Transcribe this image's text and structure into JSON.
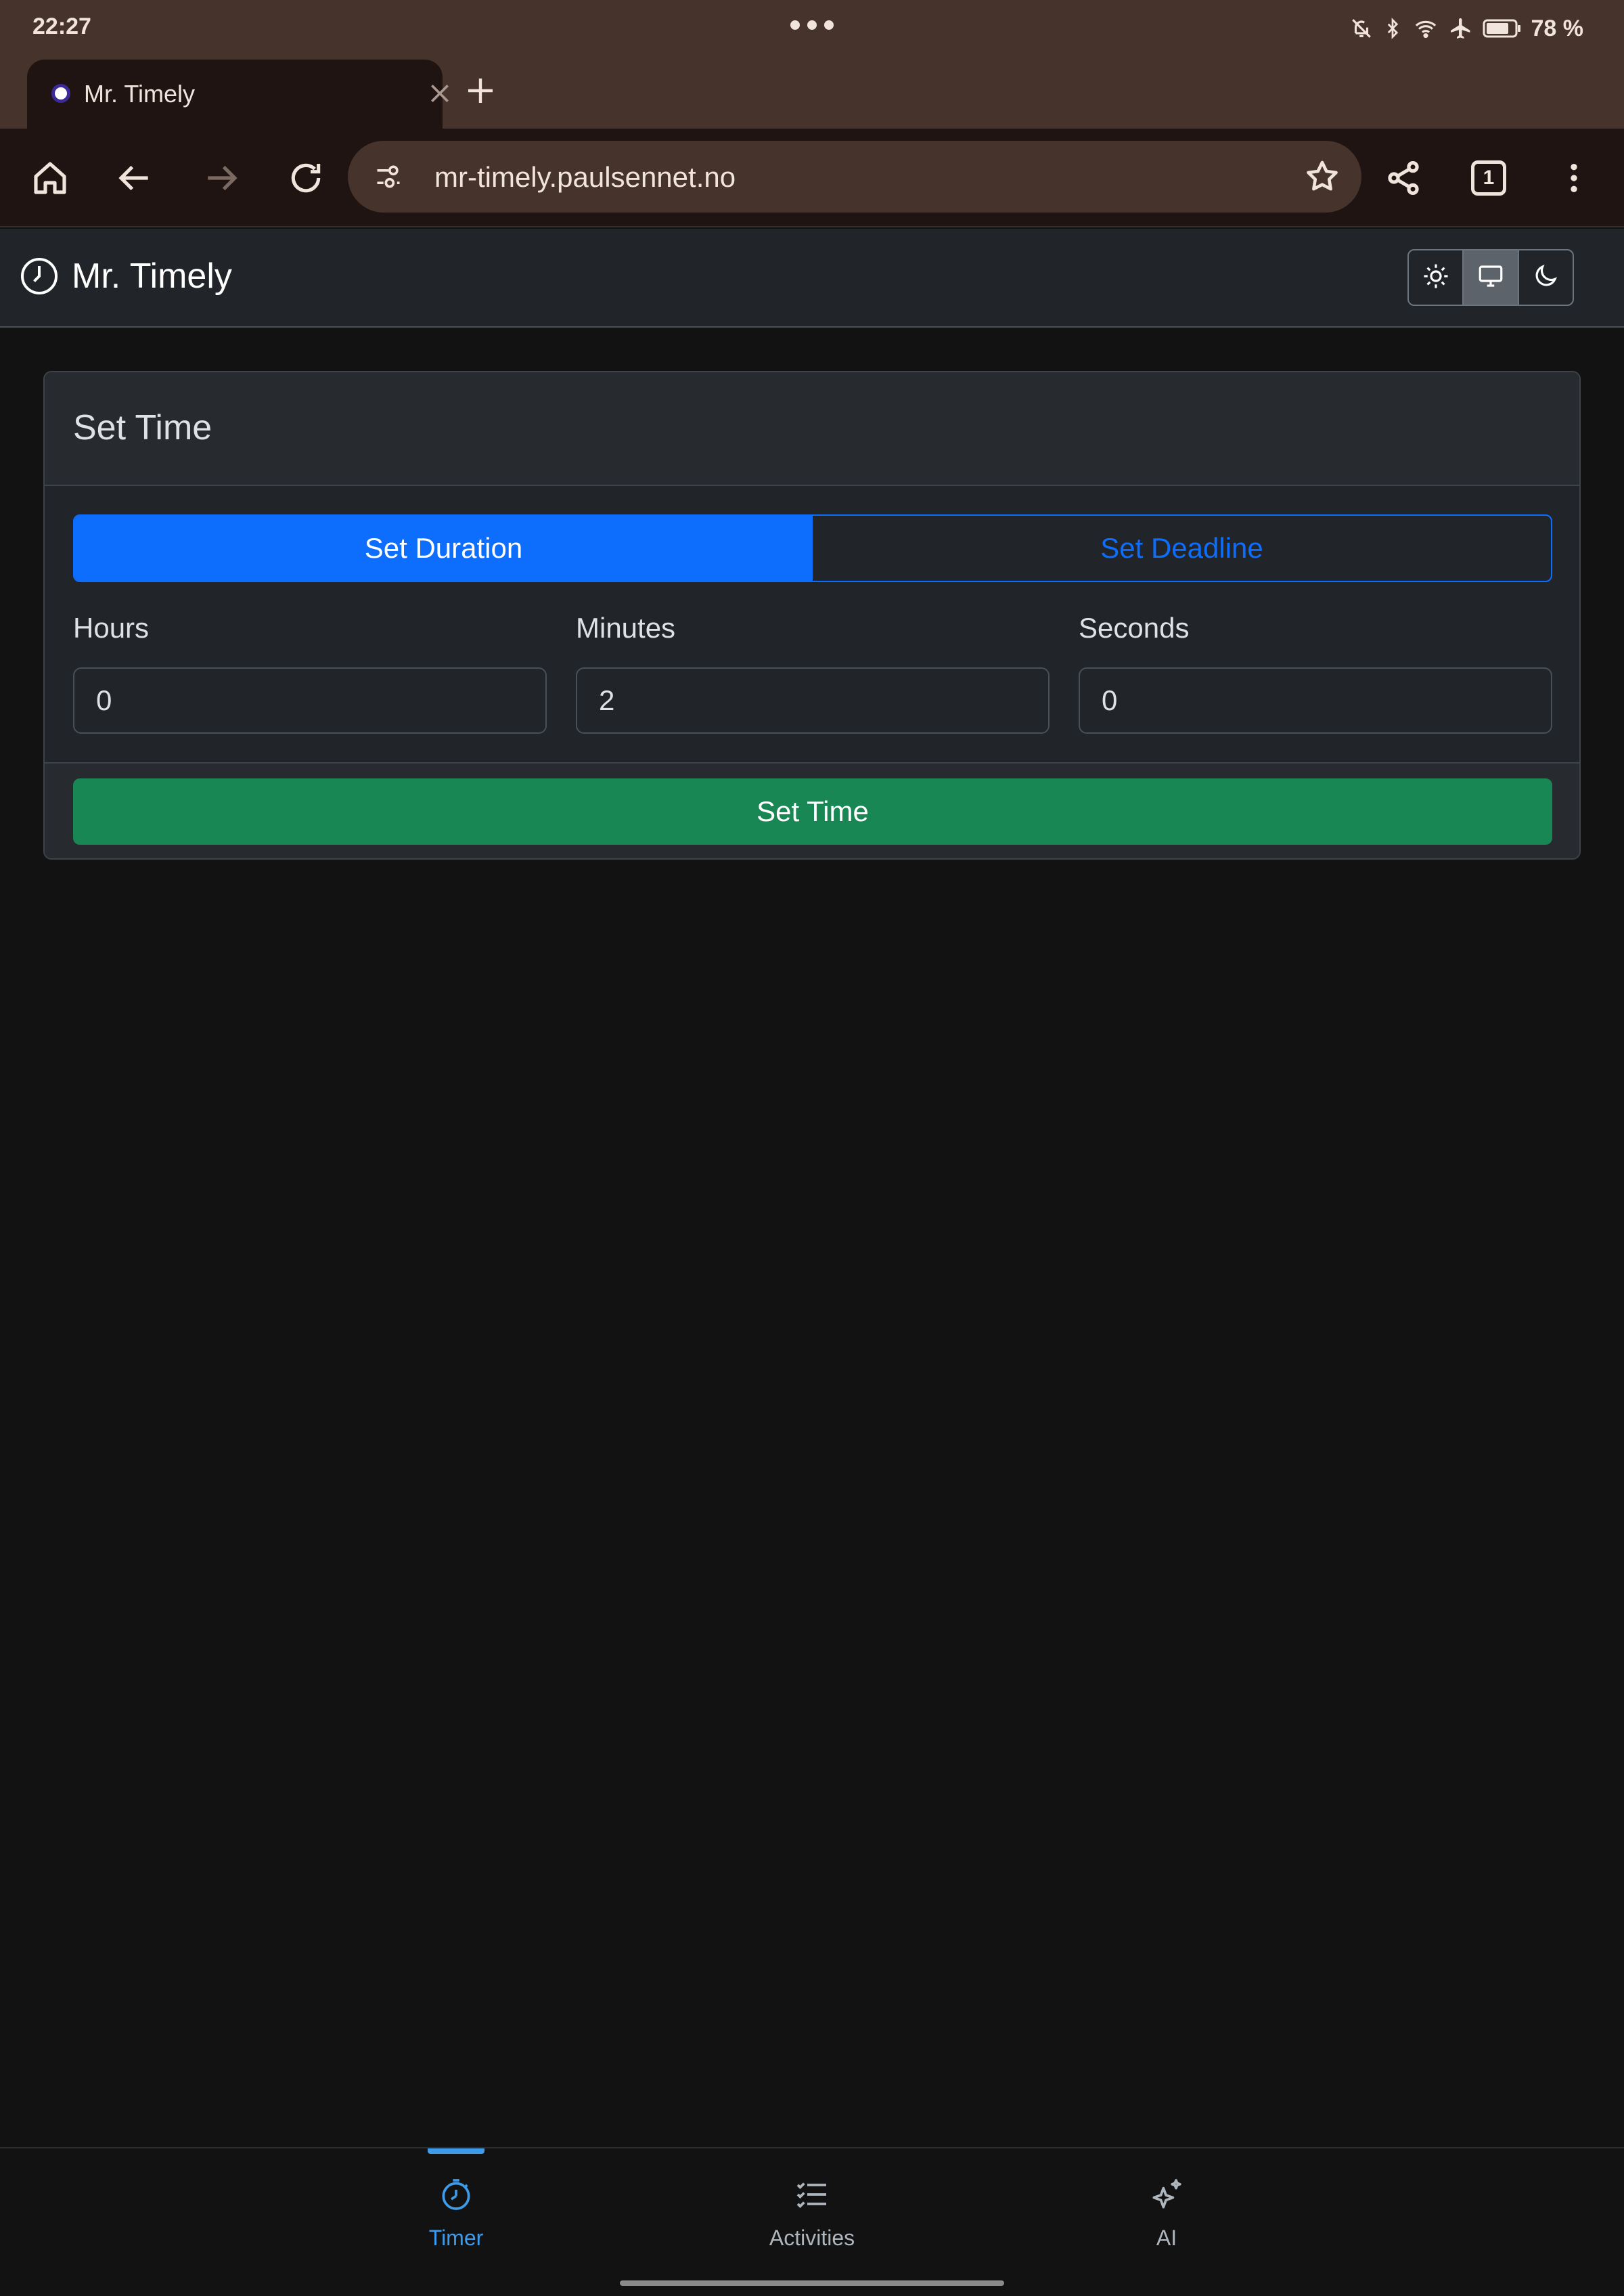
{
  "status_bar": {
    "time": "22:27",
    "battery_percent": "78 %",
    "icons": [
      "mute-icon",
      "bluetooth-icon",
      "wifi-icon",
      "airplane-icon",
      "battery-icon"
    ]
  },
  "browser": {
    "tab_title": "Mr. Timely",
    "url": "mr-timely.paulsennet.no",
    "tab_count": "1"
  },
  "app": {
    "brand": "Mr. Timely",
    "theme_options": [
      "light",
      "system",
      "dark"
    ],
    "active_theme": "system"
  },
  "card": {
    "title": "Set Time",
    "mode_tabs": {
      "duration": "Set Duration",
      "deadline": "Set Deadline",
      "active": "duration"
    },
    "fields": {
      "hours": {
        "label": "Hours",
        "value": "0"
      },
      "minutes": {
        "label": "Minutes",
        "value": "2"
      },
      "seconds": {
        "label": "Seconds",
        "value": "0"
      }
    },
    "submit_label": "Set Time"
  },
  "bottom_nav": {
    "timer": "Timer",
    "activities": "Activities",
    "ai": "AI",
    "active": "timer"
  },
  "colors": {
    "primary": "#0d6efd",
    "success": "#198754",
    "nav_active": "#3d9be9",
    "background": "#121212",
    "browser_chrome": "#45332c"
  }
}
